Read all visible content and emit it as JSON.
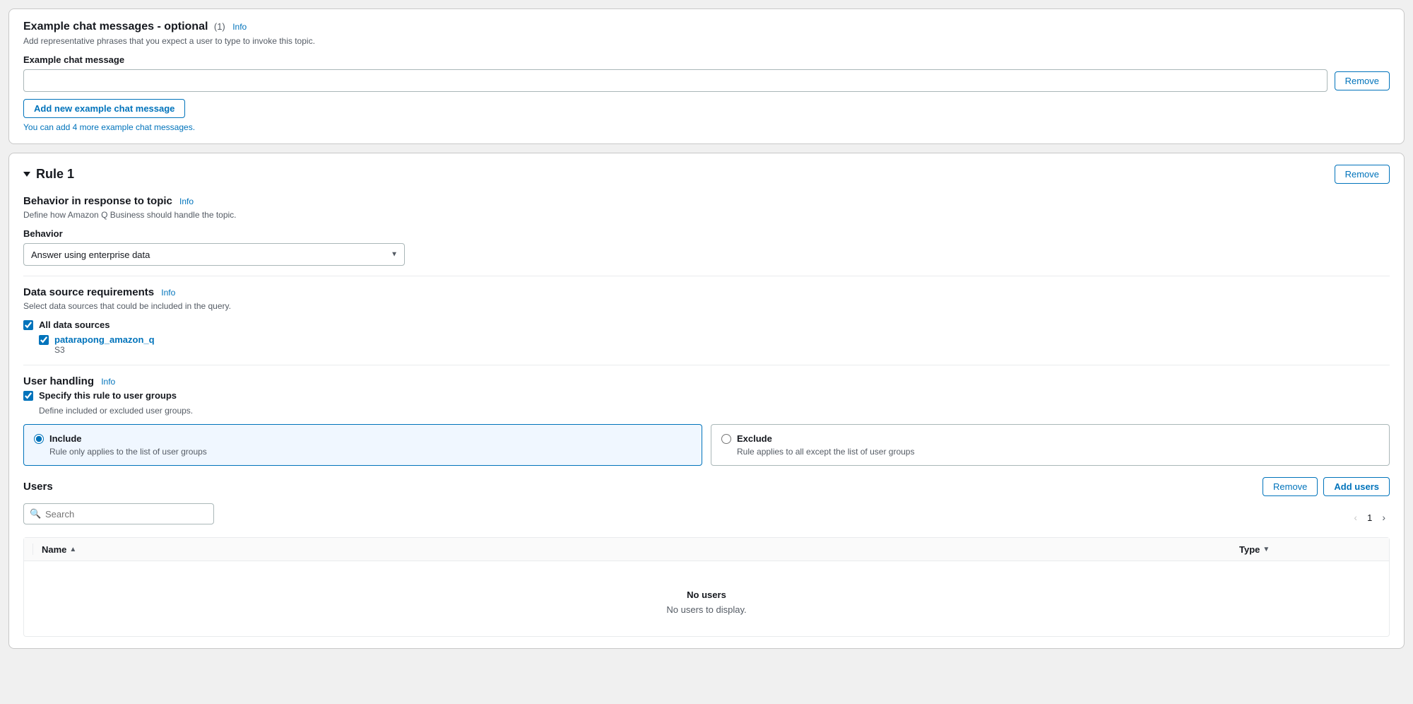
{
  "example_chat": {
    "title": "Example chat messages - optional",
    "badge": "(1)",
    "info_label": "Info",
    "subtitle": "Add representative phrases that you expect a user to type to invoke this topic.",
    "field_label": "Example chat message",
    "input_placeholder": "",
    "remove_button": "Remove",
    "add_button": "Add new example chat message",
    "hint": "You can add 4 more example chat messages."
  },
  "rule": {
    "title": "Rule 1",
    "remove_button": "Remove",
    "behavior_title": "Behavior in response to topic",
    "info_label": "Info",
    "behavior_desc": "Define how Amazon Q Business should handle the topic.",
    "behavior_field_label": "Behavior",
    "behavior_option": "Answer using enterprise data",
    "datasource_title": "Data source requirements",
    "datasource_info": "Info",
    "datasource_desc": "Select data sources that could be included in the query.",
    "all_datasources_label": "All data sources",
    "datasource_name": "patarapong_amazon_q",
    "datasource_type": "S3",
    "user_handling_title": "User handling",
    "user_handling_info": "Info",
    "user_handling_checkbox_label": "Specify this rule to user groups",
    "user_handling_checkbox_desc": "Define included or excluded user groups.",
    "include_title": "Include",
    "include_desc": "Rule only applies to the list of user groups",
    "exclude_title": "Exclude",
    "exclude_desc": "Rule applies to all except the list of user groups",
    "users_title": "Users",
    "remove_users_button": "Remove",
    "add_users_button": "Add users",
    "search_placeholder": "Search",
    "name_column": "Name",
    "type_column": "Type",
    "empty_title": "No users",
    "empty_desc": "No users to display.",
    "page_number": "1"
  }
}
